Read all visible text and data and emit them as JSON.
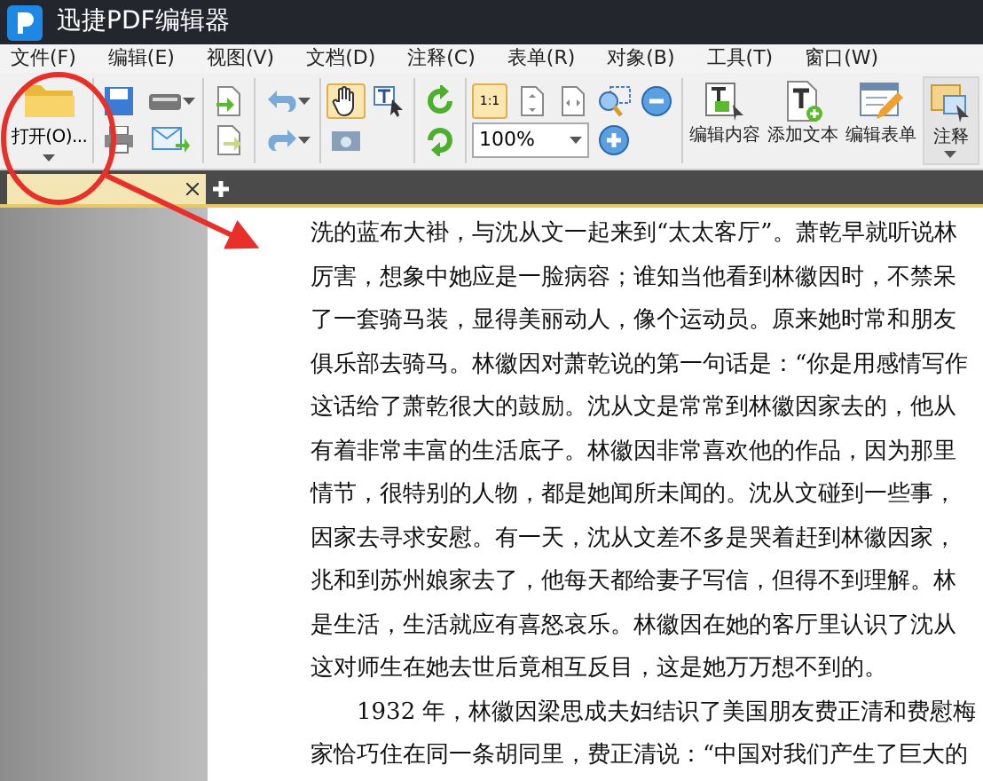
{
  "window": {
    "title": "迅捷PDF编辑器"
  },
  "menu": [
    "文件(F)",
    "编辑(E)",
    "视图(V)",
    "文档(D)",
    "注释(C)",
    "表单(R)",
    "对象(B)",
    "工具(T)",
    "窗口(W)"
  ],
  "toolbar": {
    "open_button": {
      "label": "打开(O)...",
      "dropdown": true
    },
    "hand_tool": {
      "selected": true
    },
    "actual_size": {
      "label": "1:1",
      "selected": true
    },
    "zoom_select": {
      "value": "100%"
    },
    "big_buttons": [
      {
        "label": "编辑内容",
        "dropdown": false
      },
      {
        "label": "添加文本",
        "dropdown": false
      },
      {
        "label": "编辑表单",
        "dropdown": false
      },
      {
        "label": "注释",
        "dropdown": true
      }
    ]
  },
  "tabs": [
    {
      "selected": true
    }
  ],
  "document": {
    "lines": [
      {
        "text": "洗的蓝布大褂，与沈从文一起来到“太太客厅”。萧乾早就听说林",
        "indent": false
      },
      {
        "text": "厉害，想象中她应是一脸病容；谁知当他看到林徽因时，不禁呆",
        "indent": false
      },
      {
        "text": "了一套骑马装，显得美丽动人，像个运动员。原来她时常和朋友",
        "indent": false
      },
      {
        "text": "俱乐部去骑马。林徽因对萧乾说的第一句话是：“你是用感情写作",
        "indent": false
      },
      {
        "text": "这话给了萧乾很大的鼓励。沈从文是常常到林徽因家去的，他从",
        "indent": false
      },
      {
        "text": "有着非常丰富的生活底子。林徽因非常喜欢他的作品，因为那里",
        "indent": false
      },
      {
        "text": "情节，很特别的人物，都是她闻所未闻的。沈从文碰到一些事，",
        "indent": false
      },
      {
        "text": "因家去寻求安慰。有一天，沈从文差不多是哭着赶到林徽因家，",
        "indent": false
      },
      {
        "text": "兆和到苏州娘家去了，他每天都给妻子写信，但得不到理解。林",
        "indent": false
      },
      {
        "text": "是生活，生活就应有喜怒哀乐。林徽因在她的客厅里认识了沈从",
        "indent": false
      },
      {
        "text": "这对师生在她去世后竟相互反目，这是她万万想不到的。",
        "indent": false
      },
      {
        "text": "1932 年，林徽因梁思成夫妇结识了美国朋友费正清和费慰梅",
        "indent": true
      },
      {
        "text": "家恰巧住在同一条胡同里，费正清说：“中国对我们产生了巨大的",
        "indent": false
      }
    ]
  }
}
